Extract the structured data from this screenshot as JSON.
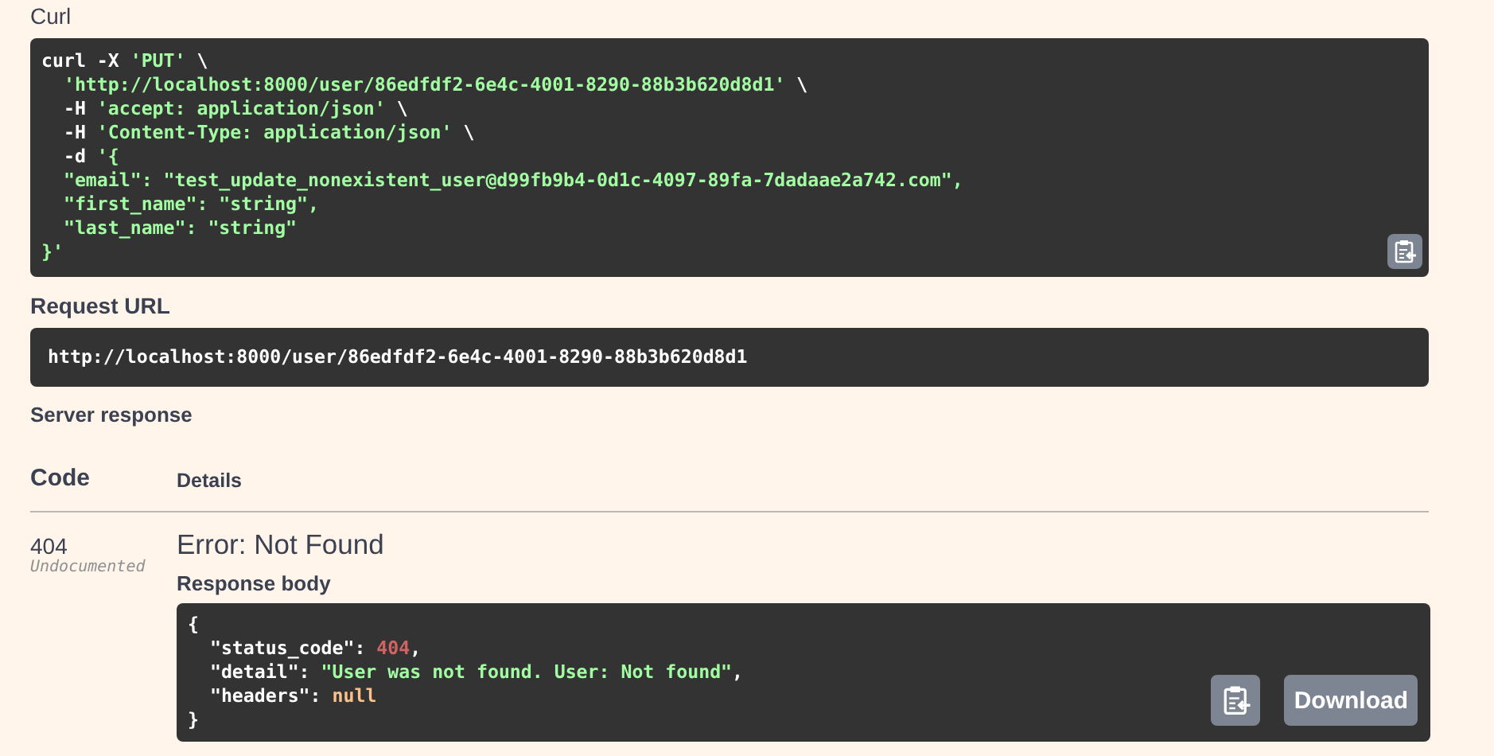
{
  "curl": {
    "label": "Curl",
    "lines": [
      [
        {
          "kind": "plain",
          "text": "curl -X "
        },
        {
          "kind": "string",
          "text": "'PUT'"
        },
        {
          "kind": "plain",
          "text": " \\"
        }
      ],
      [
        {
          "kind": "string",
          "text": "  'http://localhost:8000/user/86edfdf2-6e4c-4001-8290-88b3b620d8d1'"
        },
        {
          "kind": "plain",
          "text": " \\"
        }
      ],
      [
        {
          "kind": "plain",
          "text": "  -H "
        },
        {
          "kind": "string",
          "text": "'accept: application/json'"
        },
        {
          "kind": "plain",
          "text": " \\"
        }
      ],
      [
        {
          "kind": "plain",
          "text": "  -H "
        },
        {
          "kind": "string",
          "text": "'Content-Type: application/json'"
        },
        {
          "kind": "plain",
          "text": " \\"
        }
      ],
      [
        {
          "kind": "plain",
          "text": "  -d "
        },
        {
          "kind": "string",
          "text": "'{"
        }
      ],
      [
        {
          "kind": "string",
          "text": "  \"email\": \"test_update_nonexistent_user@d99fb9b4-0d1c-4097-89fa-7dadaae2a742.com\","
        }
      ],
      [
        {
          "kind": "string",
          "text": "  \"first_name\": \"string\","
        }
      ],
      [
        {
          "kind": "string",
          "text": "  \"last_name\": \"string\""
        }
      ],
      [
        {
          "kind": "string",
          "text": "}'"
        }
      ]
    ]
  },
  "request_url": {
    "label": "Request URL",
    "value": "http://localhost:8000/user/86edfdf2-6e4c-4001-8290-88b3b620d8d1"
  },
  "server_response": {
    "label": "Server response",
    "columns": [
      "Code",
      "Details"
    ],
    "response": {
      "code": "404",
      "code_note": "Undocumented",
      "title": "Error: Not Found",
      "body_label": "Response body",
      "body_lines": [
        [
          {
            "kind": "plain",
            "text": "{"
          }
        ],
        [
          {
            "kind": "plain",
            "text": "  \"status_code\": "
          },
          {
            "kind": "number",
            "text": "404"
          },
          {
            "kind": "plain",
            "text": ","
          }
        ],
        [
          {
            "kind": "plain",
            "text": "  \"detail\": "
          },
          {
            "kind": "string",
            "text": "\"User was not found. User: Not found\""
          },
          {
            "kind": "plain",
            "text": ","
          }
        ],
        [
          {
            "kind": "plain",
            "text": "  \"headers\": "
          },
          {
            "kind": "literal",
            "text": "null"
          }
        ],
        [
          {
            "kind": "plain",
            "text": "}"
          }
        ]
      ],
      "download": "Download"
    }
  }
}
